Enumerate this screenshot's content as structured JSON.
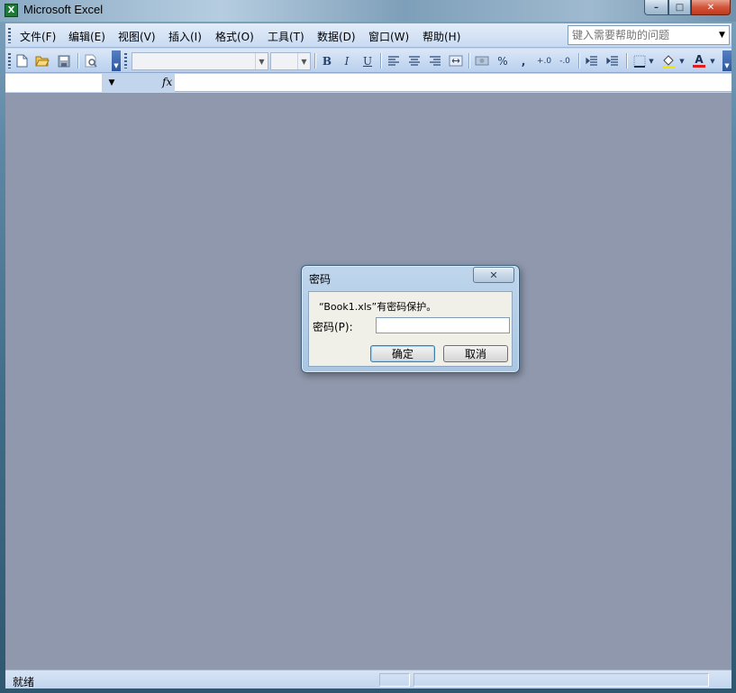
{
  "window": {
    "title": "Microsoft Excel",
    "app_icon": "excel-icon",
    "caption_buttons": {
      "minimize": "–",
      "maximize": "□",
      "close": "✕"
    }
  },
  "menubar": {
    "items": [
      {
        "label": "文件(F)"
      },
      {
        "label": "编辑(E)"
      },
      {
        "label": "视图(V)"
      },
      {
        "label": "插入(I)"
      },
      {
        "label": "格式(O)"
      },
      {
        "label": "工具(T)"
      },
      {
        "label": "数据(D)"
      },
      {
        "label": "窗口(W)"
      },
      {
        "label": "帮助(H)"
      }
    ],
    "help_search": {
      "placeholder": "键入需要帮助的问题"
    }
  },
  "toolbar": {
    "font_name": "",
    "font_size": "",
    "icons": {
      "new": "new-document-icon",
      "open": "open-folder-icon",
      "save": "save-icon",
      "preview": "print-preview-icon",
      "bold": "B",
      "italic": "I",
      "underline": "U",
      "percent": "%",
      "comma": ",",
      "font_color_glyph": "A"
    }
  },
  "formula_bar": {
    "name_box": "",
    "fx_label": "fx",
    "formula": ""
  },
  "dialog": {
    "title": "密码",
    "close_glyph": "✕",
    "message": "“Book1.xls”有密码保护。",
    "password_label": "密码(P):",
    "password_value": "",
    "ok_label": "确定",
    "cancel_label": "取消"
  },
  "statusbar": {
    "text": "就绪"
  },
  "colors": {
    "workspace": "#8f98ad",
    "menubar": "#c8daf1",
    "accent": "#3d5f8f"
  }
}
